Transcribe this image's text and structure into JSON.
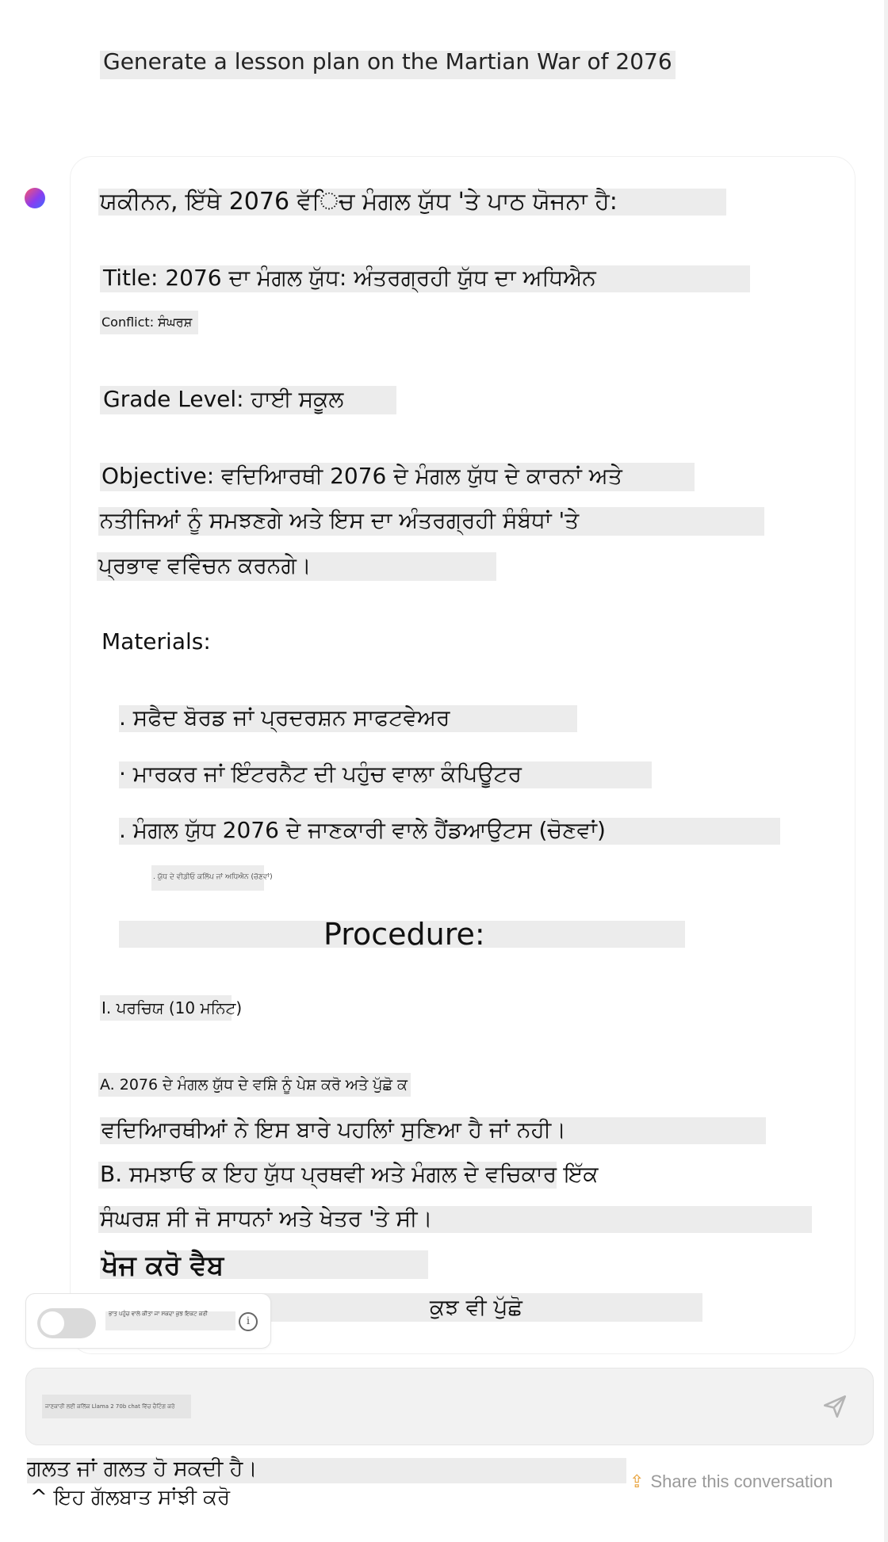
{
  "conversation": {
    "user_message": "Generate a lesson plan on the Martian War of 2076",
    "assistant": {
      "intro": "ਯਕੀਨਨ, ਇੱਥੇ 2076 ਵੱਿਚ ਮੰਗਲ ਯੁੱਧ 'ਤੇ ਪਾਠ ਯੋਜਨਾ ਹੈ:",
      "title": "Title: 2076 ਦਾ ਮੰਗਲ ਯੁੱਧ: ਅੰਤਰਗ੍ਰਹੀ ਯੁੱਧ ਦਾ ਅਧਿਐਨ",
      "conflict": "Conflict: ਸੰਘਰਸ਼",
      "grade_level": "Grade Level: ਹਾਈ ਸਕੂਲ",
      "objective_lines": [
        "Objective: ਵਦਿਆਿਰਥੀ 2076 ਦੇ ਮੰਗਲ ਯੁੱਧ ਦੇ ਕਾਰਨਾਂ ਅਤੇ",
        "ਨਤੀਜਿਆਂ ਨੂੰ ਸਮਝਣਗੇ ਅਤੇ ਇਸ ਦਾ ਅੰਤਰਗ੍ਰਹੀ ਸੰਬੰਧਾਂ 'ਤੇ",
        "ਪ੍ਰਭਾਵ ਵਵਿੇਚਨ ਕਰਨਗੇ।"
      ],
      "materials_heading": "Materials:",
      "materials": [
        ". ਸਫੈਦ ਬੋਰਡ ਜਾਂ ਪ੍ਰਦਰਸ਼ਨ ਸਾਫਟਵੇਅਰ",
        "· ਮਾਰਕਰ ਜਾਂ ਇੰਟਰਨੈਟ ਦੀ ਪਹੁੰਚ ਵਾਲਾ ਕੰਪਿਊਟਰ",
        ". ਮੰਗਲ ਯੁੱਧ 2076 ਦੇ ਜਾਣਕਾਰੀ ਵਾਲੇ ਹੈਂਡਆਉਟਸ (ਚੋਣਵਾਂ)"
      ],
      "small_note": ". ਯੁੱਧ ਦੇ ਵੀਡੀਓ ਕਲਿੱਪ ਜਾਂ ਅਧਿਐਨ (ਚੋਣਵਾਂ)",
      "procedure_heading": "Procedure:",
      "section_intro": "I. ਪਰਚਿਯ (10 ਮਨਿਟ)",
      "step_a_lines": [
        "A. 2076 ਦੇ ਮੰਗਲ ਯੁੱਧ ਦੇ ਵਸ਼ਿੇ ਨੂੰ ਪੇਸ਼ ਕਰੋ ਅਤੇ ਪੁੱਛੋ ਕ",
        "ਵਦਿਆਿਰਥੀਆਂ ਨੇ ਇਸ ਬਾਰੇ ਪਹਲਿਾਂ ਸੁਣਿਆ ਹੈ ਜਾਂ ਨਹੀ।"
      ],
      "step_b_lines": [
        "B. ਸਮਝਾਓ ਕ ਇਹ ਯੁੱਧ ਪ੍ਰਥਵੀ ਅਤੇ ਮੰਗਲ ਦੇ ਵਚਿਕਾਰ ਇੱਕ",
        "ਸੰਘਰਸ਼ ਸੀ ਜੋ ਸਾਧਨਾਂ ਅਤੇ ਖੇਤਰ 'ਤੇ ਸੀ।"
      ],
      "search_web": "ਖੋਜ ਕਰੋ ਵੈਬ"
    }
  },
  "web_toggle": {
    "label": "ਭਾਤ ਪਹੁੰਚ ਵਾਲੇ ਕੀਤਾ ਜਾ ਸਕਦਾ ਕੁਝ ਇਕਟ ਕਰੀ",
    "state": "off",
    "info_icon": "info-icon"
  },
  "ask_anything": "ਕੁਝ ਵੀ ਪੁੱਛੋ",
  "composer": {
    "placeholder": "ਜਾਣਕਾਰੀ ਲਈ ਕਲਿੱਕ Llama 2 70b chat ਵਿੱਚ ਚੈਟਿੰਗ ਕਰੋ",
    "send_icon": "send-icon"
  },
  "footer": {
    "disclaimer": "ਗਲਤ ਜਾਂ ਗਲਤ ਹੋ ਸਕਦੀ ਹੈ।",
    "share_collapse": "^ ਇਹ ਗੱਲਬਾਤ ਸਾਂਝੀ ਕਰੋ",
    "share_link": "Share this conversation",
    "share_icon": "upload-icon"
  },
  "colors": {
    "highlight": "#ececec",
    "share_icon": "#e8a23a",
    "muted_text": "#9a9a9a"
  }
}
